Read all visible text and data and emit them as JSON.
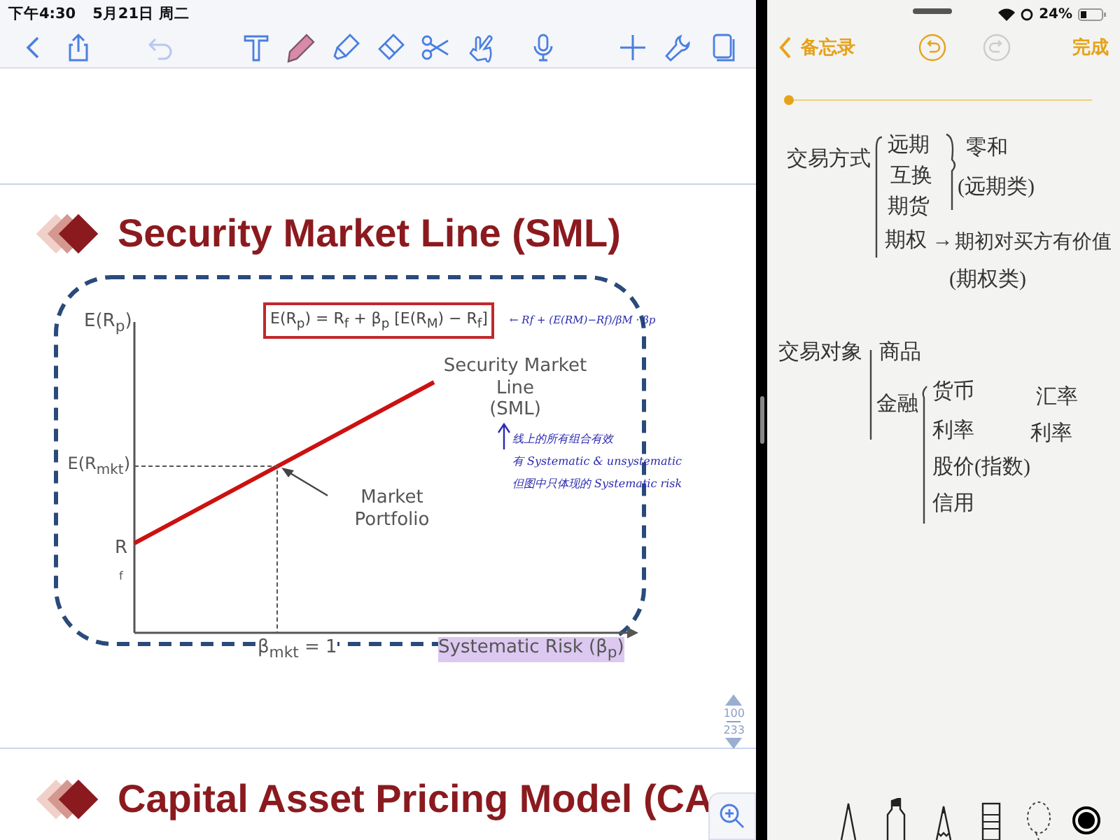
{
  "status_bar": {
    "time": "下午4:30",
    "date": "5月21日 周二"
  },
  "toolbar": [
    {
      "kind": "back",
      "selected": false,
      "disabled": false
    },
    {
      "kind": "share",
      "selected": false,
      "disabled": false
    },
    {
      "kind": "undo",
      "selected": false,
      "disabled": true
    },
    {
      "kind": "text",
      "selected": false,
      "disabled": false
    },
    {
      "kind": "pencil",
      "selected": true,
      "disabled": false
    },
    {
      "kind": "highlighter",
      "selected": false,
      "disabled": false
    },
    {
      "kind": "eraser",
      "selected": false,
      "disabled": false
    },
    {
      "kind": "scissors",
      "selected": false,
      "disabled": false
    },
    {
      "kind": "hand",
      "selected": false,
      "disabled": false
    },
    {
      "kind": "mic",
      "selected": false,
      "disabled": false
    },
    {
      "kind": "plus",
      "selected": false,
      "disabled": false
    },
    {
      "kind": "wrench",
      "selected": false,
      "disabled": false
    },
    {
      "kind": "pages",
      "selected": false,
      "disabled": false
    }
  ],
  "slide": {
    "title": "Security Market Line (SML)",
    "diagram": {
      "y_axis_label": "E(R$_{p}$)",
      "formula": "E(R$_{p}$) = R$_{f}$ + β$_{p}$ [E(R$_{M}$) − R$_{f}$]",
      "formula_note": "← Rf + (E(RM)−Rf)/βM · βp",
      "line_label": [
        "Security Market",
        "Line",
        "(SML)"
      ],
      "market_return_label": "E(R$_{mkt}$)",
      "market_label": [
        "Market",
        "Portfolio"
      ],
      "rf_label": "R",
      "rf_subscript": "f",
      "beta_label": "β$_{mkt}$ = 1",
      "x_axis_label": "Systematic Risk (β$_{p}$)",
      "annotation": [
        "线上的所有组合有效",
        "有 Systematic & unsystematic",
        "但图中只体现的 Systematic risk"
      ]
    },
    "next_title": "Capital Asset Pricing Model (CA"
  },
  "page_indicator": {
    "current": "100",
    "total": "233"
  },
  "notes": {
    "battery": "24%",
    "back_label": "备忘录",
    "redo_disabled": true,
    "done_label": "完成",
    "handwriting": [
      "交易方式",
      "远期",
      "互换",
      "期货",
      "零和",
      "(远期类)",
      "期权 →",
      "期初对买方有价值",
      "(期权类)",
      "交易对象",
      "商品",
      "金融",
      "货币",
      "利率",
      "股价(指数)",
      "信用",
      "汇率",
      "利率"
    ],
    "pen_tools": [
      {
        "kind": "pen",
        "selected": false
      },
      {
        "kind": "marker",
        "selected": false
      },
      {
        "kind": "pencil",
        "selected": false
      },
      {
        "kind": "eraser",
        "selected": false
      },
      {
        "kind": "lasso",
        "selected": false
      },
      {
        "kind": "color",
        "selected": true
      }
    ]
  }
}
